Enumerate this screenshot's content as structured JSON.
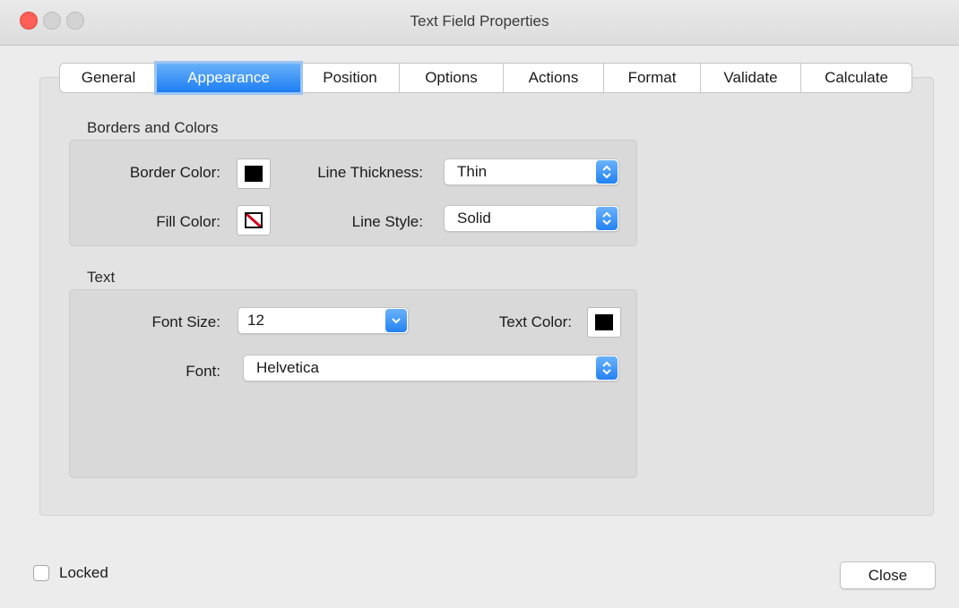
{
  "window": {
    "title": "Text Field Properties"
  },
  "tabs": [
    {
      "label": "General",
      "active": false
    },
    {
      "label": "Appearance",
      "active": true
    },
    {
      "label": "Position",
      "active": false
    },
    {
      "label": "Options",
      "active": false
    },
    {
      "label": "Actions",
      "active": false
    },
    {
      "label": "Format",
      "active": false
    },
    {
      "label": "Validate",
      "active": false
    },
    {
      "label": "Calculate",
      "active": false
    }
  ],
  "borders": {
    "section_label": "Borders and Colors",
    "border_color_label": "Border Color:",
    "border_color": "#000000",
    "fill_color_label": "Fill Color:",
    "fill_color": "none",
    "line_thickness_label": "Line Thickness:",
    "line_thickness_value": "Thin",
    "line_style_label": "Line Style:",
    "line_style_value": "Solid"
  },
  "text": {
    "section_label": "Text",
    "font_size_label": "Font Size:",
    "font_size_value": "12",
    "text_color_label": "Text Color:",
    "text_color": "#000000",
    "font_label": "Font:",
    "font_value": "Helvetica"
  },
  "footer": {
    "locked_label": "Locked",
    "locked_checked": false,
    "close_label": "Close"
  },
  "colors": {
    "accent": "#1d7ef2",
    "close_light": "#fc5f57"
  }
}
